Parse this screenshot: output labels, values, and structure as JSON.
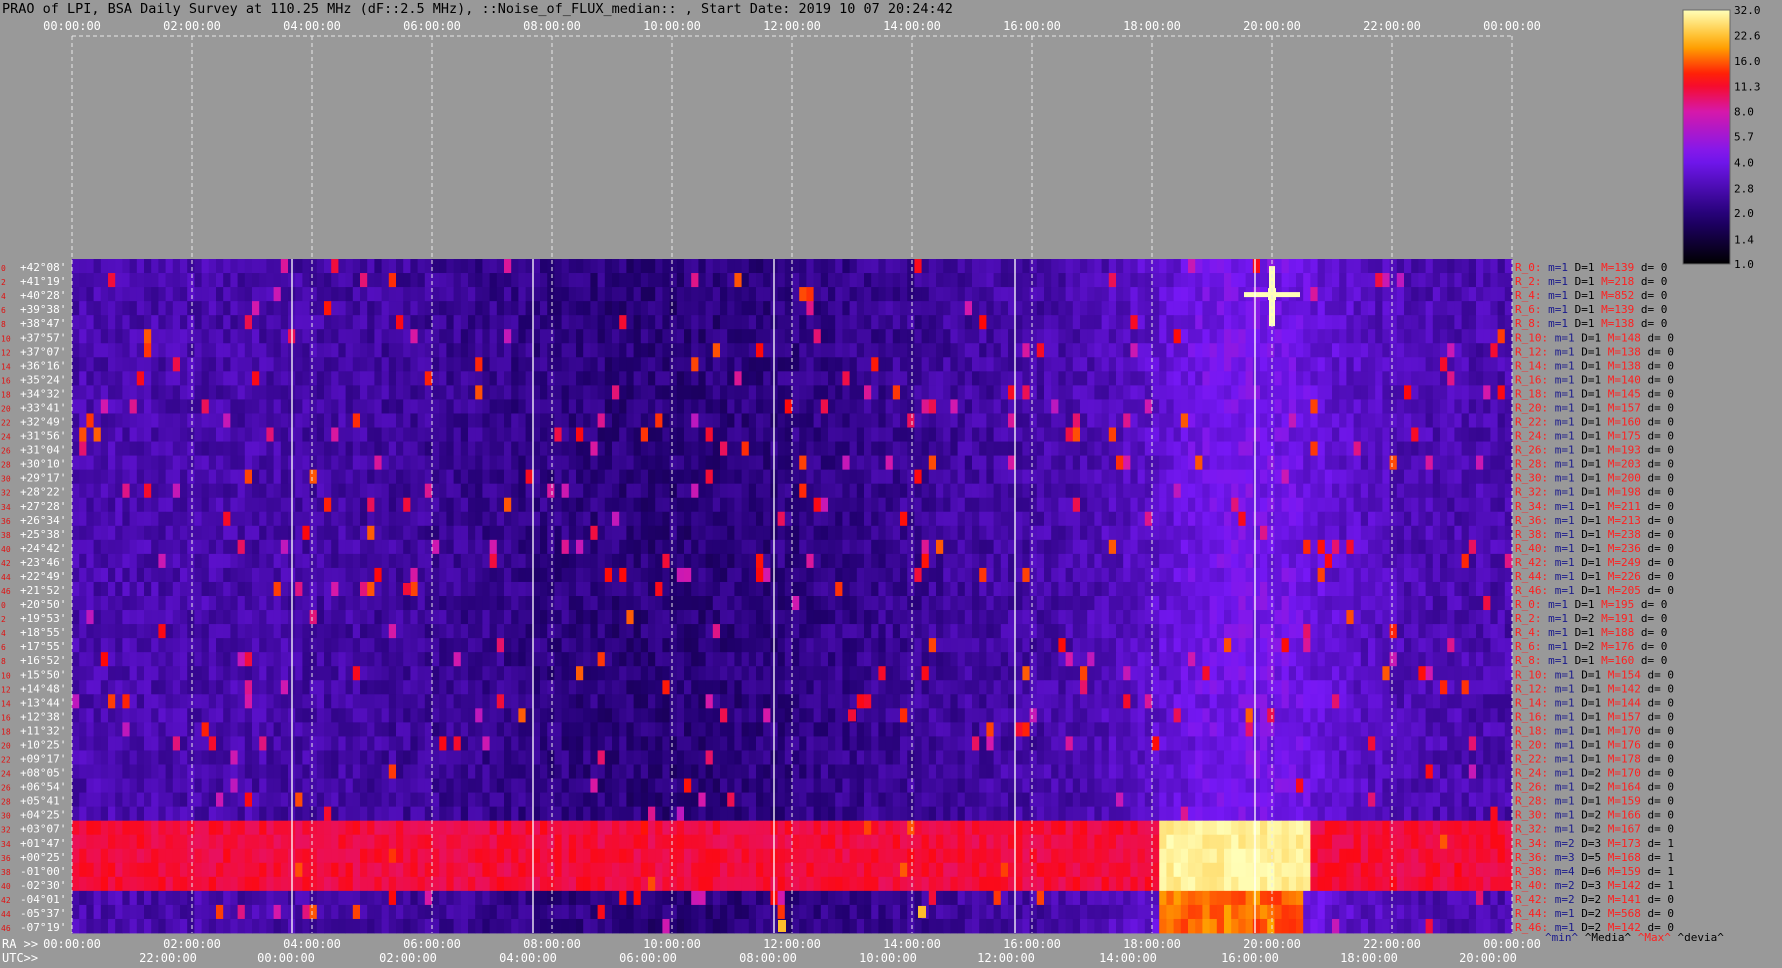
{
  "title": "PRAO of LPI, BSA Daily Survey at 110.25 MHz (dF::2.5 MHz), ::Noise_of_FLUX_median:: , Start Date: 2019 10 07 20:24:42",
  "axes": {
    "top_ticks": [
      "00:00:00",
      "02:00:00",
      "04:00:00",
      "06:00:00",
      "08:00:00",
      "10:00:00",
      "12:00:00",
      "14:00:00",
      "16:00:00",
      "18:00:00",
      "20:00:00",
      "22:00:00",
      "00:00:00"
    ],
    "ra_label": "RA >>",
    "ra_ticks": [
      "00:00:00",
      "02:00:00",
      "04:00:00",
      "06:00:00",
      "08:00:00",
      "10:00:00",
      "12:00:00",
      "14:00:00",
      "16:00:00",
      "18:00:00",
      "20:00:00",
      "22:00:00",
      "00:00:00"
    ],
    "utc_label": "UTC>>",
    "utc_ticks": [
      "22:00:00",
      "00:00:00",
      "02:00:00",
      "04:00:00",
      "06:00:00",
      "08:00:00",
      "10:00:00",
      "12:00:00",
      "14:00:00",
      "16:00:00",
      "18:00:00",
      "20:00:00"
    ]
  },
  "colorbar": {
    "ticks": [
      "32.0",
      "22.6",
      "16.0",
      "11.3",
      "8.0",
      "5.7",
      "4.0",
      "2.8",
      "2.0",
      "1.4",
      "1.0"
    ]
  },
  "declinations": [
    "+42°08'",
    "+41°19'",
    "+40°28'",
    "+39°38'",
    "+38°47'",
    "+37°57'",
    "+37°07'",
    "+36°16'",
    "+35°24'",
    "+34°32'",
    "+33°41'",
    "+32°49'",
    "+31°56'",
    "+31°04'",
    "+30°10'",
    "+29°17'",
    "+28°22'",
    "+27°28'",
    "+26°34'",
    "+25°38'",
    "+24°42'",
    "+23°46'",
    "+22°49'",
    "+21°52'",
    "+20°50'",
    "+19°53'",
    "+18°55'",
    "+17°55'",
    "+16°52'",
    "+15°50'",
    "+14°48'",
    "+13°44'",
    "+12°38'",
    "+11°32'",
    "+10°25'",
    "+09°17'",
    "+08°05'",
    "+06°54'",
    "+05°41'",
    "+04°25'",
    "+03°07'",
    "+01°47'",
    "+00°25'",
    "-01°00'",
    "-02°30'",
    "-04°01'",
    "-05°37'",
    "-07°19'"
  ],
  "row_indices": [
    "0",
    "2",
    "4",
    "6",
    "8",
    "10",
    "12",
    "14",
    "16",
    "18",
    "20",
    "22",
    "24",
    "26",
    "28",
    "30",
    "32",
    "34",
    "36",
    "38",
    "40",
    "42",
    "44",
    "46",
    "0",
    "2",
    "4",
    "6",
    "8",
    "10",
    "12",
    "14",
    "16",
    "18",
    "20",
    "22",
    "24",
    "26",
    "28",
    "30",
    "32",
    "34",
    "36",
    "38",
    "40",
    "42",
    "44",
    "46"
  ],
  "row_stats": [
    {
      "r": "R_0:",
      "m": "m=1",
      "D": "D=1",
      "M": "M=139",
      "d": "d= 0"
    },
    {
      "r": "R_2:",
      "m": "m=1",
      "D": "D=1",
      "M": "M=218",
      "d": "d= 0"
    },
    {
      "r": "R_4:",
      "m": "m=1",
      "D": "D=1",
      "M": "M=852",
      "d": "d= 0"
    },
    {
      "r": "R_6:",
      "m": "m=1",
      "D": "D=1",
      "M": "M=139",
      "d": "d= 0"
    },
    {
      "r": "R_8:",
      "m": "m=1",
      "D": "D=1",
      "M": "M=138",
      "d": "d= 0"
    },
    {
      "r": "R_10:",
      "m": "m=1",
      "D": "D=1",
      "M": "M=148",
      "d": "d= 0"
    },
    {
      "r": "R_12:",
      "m": "m=1",
      "D": "D=1",
      "M": "M=138",
      "d": "d= 0"
    },
    {
      "r": "R_14:",
      "m": "m=1",
      "D": "D=1",
      "M": "M=138",
      "d": "d= 0"
    },
    {
      "r": "R_16:",
      "m": "m=1",
      "D": "D=1",
      "M": "M=140",
      "d": "d= 0"
    },
    {
      "r": "R_18:",
      "m": "m=1",
      "D": "D=1",
      "M": "M=145",
      "d": "d= 0"
    },
    {
      "r": "R_20:",
      "m": "m=1",
      "D": "D=1",
      "M": "M=157",
      "d": "d= 0"
    },
    {
      "r": "R_22:",
      "m": "m=1",
      "D": "D=1",
      "M": "M=160",
      "d": "d= 0"
    },
    {
      "r": "R_24:",
      "m": "m=1",
      "D": "D=1",
      "M": "M=175",
      "d": "d= 0"
    },
    {
      "r": "R_26:",
      "m": "m=1",
      "D": "D=1",
      "M": "M=193",
      "d": "d= 0"
    },
    {
      "r": "R_28:",
      "m": "m=1",
      "D": "D=1",
      "M": "M=203",
      "d": "d= 0"
    },
    {
      "r": "R_30:",
      "m": "m=1",
      "D": "D=1",
      "M": "M=200",
      "d": "d= 0"
    },
    {
      "r": "R_32:",
      "m": "m=1",
      "D": "D=1",
      "M": "M=198",
      "d": "d= 0"
    },
    {
      "r": "R_34:",
      "m": "m=1",
      "D": "D=1",
      "M": "M=211",
      "d": "d= 0"
    },
    {
      "r": "R_36:",
      "m": "m=1",
      "D": "D=1",
      "M": "M=213",
      "d": "d= 0"
    },
    {
      "r": "R_38:",
      "m": "m=1",
      "D": "D=1",
      "M": "M=238",
      "d": "d= 0"
    },
    {
      "r": "R_40:",
      "m": "m=1",
      "D": "D=1",
      "M": "M=236",
      "d": "d= 0"
    },
    {
      "r": "R_42:",
      "m": "m=1",
      "D": "D=1",
      "M": "M=249",
      "d": "d= 0"
    },
    {
      "r": "R_44:",
      "m": "m=1",
      "D": "D=1",
      "M": "M=226",
      "d": "d= 0"
    },
    {
      "r": "R_46:",
      "m": "m=1",
      "D": "D=1",
      "M": "M=205",
      "d": "d= 0"
    },
    {
      "r": "R_0:",
      "m": "m=1",
      "D": "D=1",
      "M": "M=195",
      "d": "d= 0"
    },
    {
      "r": "R_2:",
      "m": "m=1",
      "D": "D=2",
      "M": "M=191",
      "d": "d= 0"
    },
    {
      "r": "R_4:",
      "m": "m=1",
      "D": "D=1",
      "M": "M=188",
      "d": "d= 0"
    },
    {
      "r": "R_6:",
      "m": "m=1",
      "D": "D=2",
      "M": "M=176",
      "d": "d= 0"
    },
    {
      "r": "R_8:",
      "m": "m=1",
      "D": "D=1",
      "M": "M=160",
      "d": "d= 0"
    },
    {
      "r": "R_10:",
      "m": "m=1",
      "D": "D=1",
      "M": "M=154",
      "d": "d= 0"
    },
    {
      "r": "R_12:",
      "m": "m=1",
      "D": "D=1",
      "M": "M=142",
      "d": "d= 0"
    },
    {
      "r": "R_14:",
      "m": "m=1",
      "D": "D=1",
      "M": "M=144",
      "d": "d= 0"
    },
    {
      "r": "R_16:",
      "m": "m=1",
      "D": "D=1",
      "M": "M=157",
      "d": "d= 0"
    },
    {
      "r": "R_18:",
      "m": "m=1",
      "D": "D=1",
      "M": "M=170",
      "d": "d= 0"
    },
    {
      "r": "R_20:",
      "m": "m=1",
      "D": "D=1",
      "M": "M=176",
      "d": "d= 0"
    },
    {
      "r": "R_22:",
      "m": "m=1",
      "D": "D=1",
      "M": "M=178",
      "d": "d= 0"
    },
    {
      "r": "R_24:",
      "m": "m=1",
      "D": "D=2",
      "M": "M=170",
      "d": "d= 0"
    },
    {
      "r": "R_26:",
      "m": "m=1",
      "D": "D=2",
      "M": "M=164",
      "d": "d= 0"
    },
    {
      "r": "R_28:",
      "m": "m=1",
      "D": "D=1",
      "M": "M=159",
      "d": "d= 0"
    },
    {
      "r": "R_30:",
      "m": "m=1",
      "D": "D=2",
      "M": "M=166",
      "d": "d= 0"
    },
    {
      "r": "R_32:",
      "m": "m=1",
      "D": "D=2",
      "M": "M=167",
      "d": "d= 0"
    },
    {
      "r": "R_34:",
      "m": "m=2",
      "D": "D=3",
      "M": "M=173",
      "d": "d= 1"
    },
    {
      "r": "R_36:",
      "m": "m=3",
      "D": "D=5",
      "M": "M=168",
      "d": "d= 1"
    },
    {
      "r": "R_38:",
      "m": "m=4",
      "D": "D=6",
      "M": "M=159",
      "d": "d= 1"
    },
    {
      "r": "R_40:",
      "m": "m=2",
      "D": "D=3",
      "M": "M=142",
      "d": "d= 1"
    },
    {
      "r": "R_42:",
      "m": "m=2",
      "D": "D=2",
      "M": "M=141",
      "d": "d= 0"
    },
    {
      "r": "R_44:",
      "m": "m=1",
      "D": "D=2",
      "M": "M=568",
      "d": "d= 0"
    },
    {
      "r": "R_46:",
      "m": "m=1",
      "D": "D=2",
      "M": "M=142",
      "d": "d= 0"
    }
  ],
  "legend": {
    "min": "^min^",
    "median": "^Media^",
    "max": "^Max^",
    "devia": "^devia^"
  },
  "colors": {
    "background": "#999999",
    "min": "#1a1a8c",
    "max": "#ff2020",
    "median": "#000000",
    "devia": "#000000",
    "row_label": "#ff2020",
    "index_label": "#e01010"
  },
  "chart_data": {
    "type": "heatmap",
    "title": "PRAO of LPI, BSA Daily Survey at 110.25 MHz (dF::2.5 MHz), ::Noise_of_FLUX_median:: , Start Date: 2019 10 07 20:24:42",
    "x_axis_top": [
      "00:00:00",
      "02:00:00",
      "04:00:00",
      "06:00:00",
      "08:00:00",
      "10:00:00",
      "12:00:00",
      "14:00:00",
      "16:00:00",
      "18:00:00",
      "20:00:00",
      "22:00:00",
      "00:00:00"
    ],
    "x_axis_ra": [
      "00:00:00",
      "02:00:00",
      "04:00:00",
      "06:00:00",
      "08:00:00",
      "10:00:00",
      "12:00:00",
      "14:00:00",
      "16:00:00",
      "18:00:00",
      "20:00:00",
      "22:00:00",
      "00:00:00"
    ],
    "x_axis_utc": [
      "22:00:00",
      "00:00:00",
      "02:00:00",
      "04:00:00",
      "06:00:00",
      "08:00:00",
      "10:00:00",
      "12:00:00",
      "14:00:00",
      "16:00:00",
      "18:00:00",
      "20:00:00"
    ],
    "y_axis": "declination rows +42°08' to -07°19' (48 beams)",
    "color_scale": [
      1.0,
      32.0
    ],
    "color_scale_type": "log",
    "features": [
      {
        "kind": "source",
        "ra": "20:00",
        "dec": "+40°28'",
        "level": 32
      },
      {
        "kind": "source",
        "ra": "05:35",
        "dec": "+21°52'",
        "level": 11
      },
      {
        "kind": "source",
        "ra": "13:00",
        "dec": "+12°38'",
        "level": 11
      },
      {
        "kind": "source",
        "ra": "14:10",
        "dec": "-05°37'",
        "level": 22
      },
      {
        "kind": "source",
        "ra": "11:50",
        "dec": "-07°19'",
        "level": 22
      },
      {
        "kind": "band",
        "dec_range": [
          "+01°47'",
          "-02°30'"
        ],
        "level": 8
      },
      {
        "kind": "band",
        "ra_range": [
          "18:10",
          "20:40"
        ],
        "dec_range": [
          "+01°47'",
          "-07°19'"
        ],
        "level": 32
      }
    ]
  }
}
